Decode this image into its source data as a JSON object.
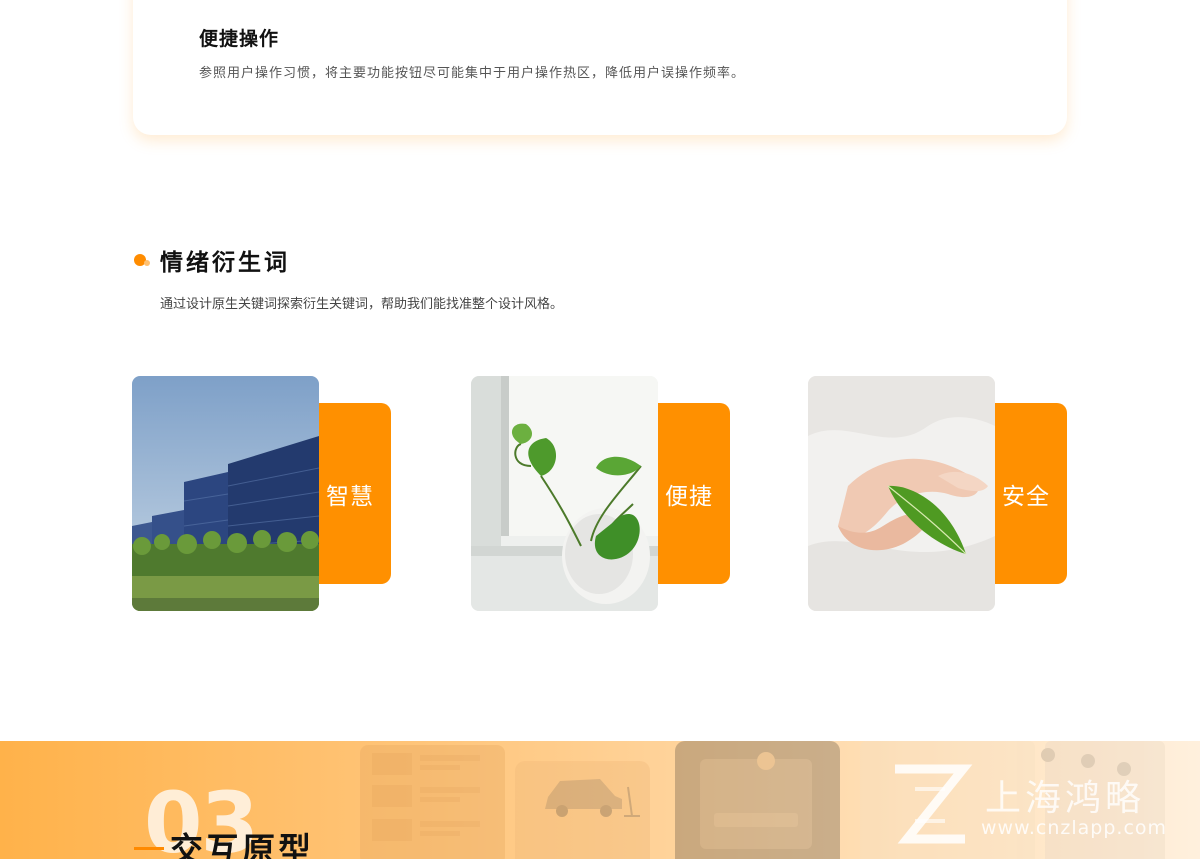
{
  "top_card": {
    "title": "便捷操作",
    "description": "参照用户操作习惯，将主要功能按钮尽可能集中于用户操作热区，降低用户误操作频率。"
  },
  "section": {
    "title": "情绪衍生词",
    "description": "通过设计原生关键词探索衍生关键词，帮助我们能找准整个设计风格。"
  },
  "keywords": [
    {
      "label": "智慧",
      "image": "office-buildings-photo"
    },
    {
      "label": "便捷",
      "image": "potted-plant-photo"
    },
    {
      "label": "安全",
      "image": "hands-leaf-photo"
    }
  ],
  "bottom_band": {
    "number": "03",
    "title": "交互原型"
  },
  "watermark": {
    "brand": "上海鸿略",
    "url": "www.cnzlapp.com"
  },
  "colors": {
    "accent": "#ff9000",
    "accent_light": "#ffc070",
    "band_start": "#ffb24a",
    "band_end": "#fff0dd"
  }
}
